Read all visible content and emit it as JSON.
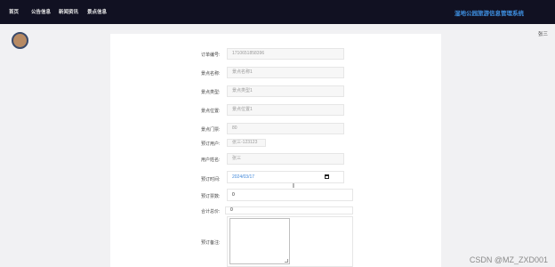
{
  "topbar": {
    "nav": [
      "首页",
      "公告信息",
      "新闻资讯",
      "景点信息"
    ],
    "brand": "湿地公园旅游信息管理系统"
  },
  "user": {
    "name": "张三"
  },
  "form": {
    "order_no_label": "订单编号:",
    "order_no_value": "1710651858396",
    "spot_name_label": "景点名称:",
    "spot_name_value": "景点名称1",
    "spot_type_label": "景点类型:",
    "spot_type_value": "景点类型1",
    "spot_location_label": "景点位置:",
    "spot_location_value": "景点位置1",
    "ticket_price_label": "景点门票:",
    "ticket_price_value": "80",
    "booking_user_label": "预订用户:",
    "booking_user_value": "张三-123123",
    "user_name_label": "用户姓名:",
    "user_name_value": "张三",
    "booking_time_label": "预订时间:",
    "booking_time_value": "2024/03/17",
    "booking_qty_label": "预订票数:",
    "booking_qty_value": "0",
    "total_label": "合计总价:",
    "total_value": "0",
    "remark_label": "预订备注:",
    "remark_value": ""
  },
  "watermark": "CSDN @MZ_ZXD001"
}
